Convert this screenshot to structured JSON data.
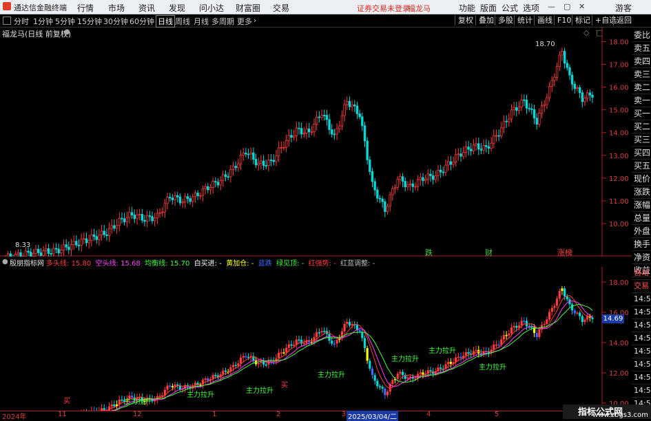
{
  "menubar": {
    "app_name": "通达信金融终端",
    "items": [
      "行情",
      "市场",
      "资讯",
      "发现",
      "问小达",
      "财富圈",
      "交易"
    ],
    "warning": "证券交易未登录",
    "stock": "福龙马",
    "right_items": [
      "功能",
      "版面",
      "公式",
      "选项"
    ],
    "user": "游客"
  },
  "toolbar": {
    "periods": [
      "分时",
      "1分钟",
      "5分钟",
      "15分钟",
      "30分钟",
      "60分钟",
      "日线",
      "周线",
      "月线",
      "多周期",
      "更多"
    ],
    "active_period": "日线",
    "buttons": [
      "复权",
      "叠加",
      "多股",
      "统计",
      "画线",
      "F10",
      "标记",
      "+自选",
      "返回"
    ]
  },
  "main_chart": {
    "title": "福龙马(日线 前复权)",
    "high_label": "18.70",
    "low_label": "8.33",
    "price_ticks": [
      "18.00",
      "17.00",
      "16.00",
      "15.00",
      "14.00",
      "13.00",
      "12.00",
      "11.00",
      "10.00"
    ],
    "event_tags": [
      "跌",
      "财",
      "涨榜"
    ]
  },
  "sub_chart": {
    "title": "殷朋指标网",
    "items": [
      {
        "label": "多头线:",
        "value": "15.80",
        "color": "#ff3b3b"
      },
      {
        "label": "空头线:",
        "value": "15.68",
        "color": "#ff40ff"
      },
      {
        "label": "均衡线:",
        "value": "15.70",
        "color": "#40ff40"
      },
      {
        "label": "白买进:",
        "value": "-",
        "color": "#ffffff"
      },
      {
        "label": "黄加仓:",
        "value": "-",
        "color": "#ffff00"
      },
      {
        "label": "蓝跌",
        "value": "",
        "color": "#3b6bff"
      },
      {
        "label": "绿见顶:",
        "value": "-",
        "color": "#40ff40"
      },
      {
        "label": "红强势:",
        "value": "-",
        "color": "#ff3b3b"
      },
      {
        "label": "红蓝调整:",
        "value": "-",
        "color": "#bbbbbb"
      }
    ],
    "price_ticks": [
      "18.00",
      "16.00",
      "14.00",
      "12.00",
      "10.00"
    ],
    "current_value": "14.69",
    "annotations": [
      "主力拉升",
      "主力拉升",
      "主力拉升",
      "主力拉升",
      "主力拉升",
      "主力拉升",
      "主力拉升"
    ],
    "buy_labels": [
      "买",
      "买"
    ]
  },
  "side_panel": {
    "items": [
      "委比",
      "卖五",
      "卖四",
      "卖三",
      "卖二",
      "卖一",
      "买一",
      "买二",
      "买三",
      "买四",
      "买五",
      "现价",
      "涨跌",
      "涨幅",
      "总量",
      "外盘",
      "换手",
      "净资",
      "收益"
    ],
    "lower_items": [
      "自动",
      "交易",
      "14:56",
      "14:56",
      "14:56",
      "14:56",
      "14:56",
      "14:56",
      "14:56",
      "14:56",
      "14:56"
    ]
  },
  "date_axis": {
    "labels": [
      "2024年",
      "11",
      "12",
      "1",
      "2",
      "3",
      "2025/03/04/二",
      "4",
      "5"
    ]
  },
  "watermark": {
    "text": "指标公式网",
    "url": "www.zbgs3.com"
  },
  "colors": {
    "up": "#ff3b3b",
    "down": "#00e0e0",
    "axis": "#b02020",
    "background": "#000000"
  }
}
